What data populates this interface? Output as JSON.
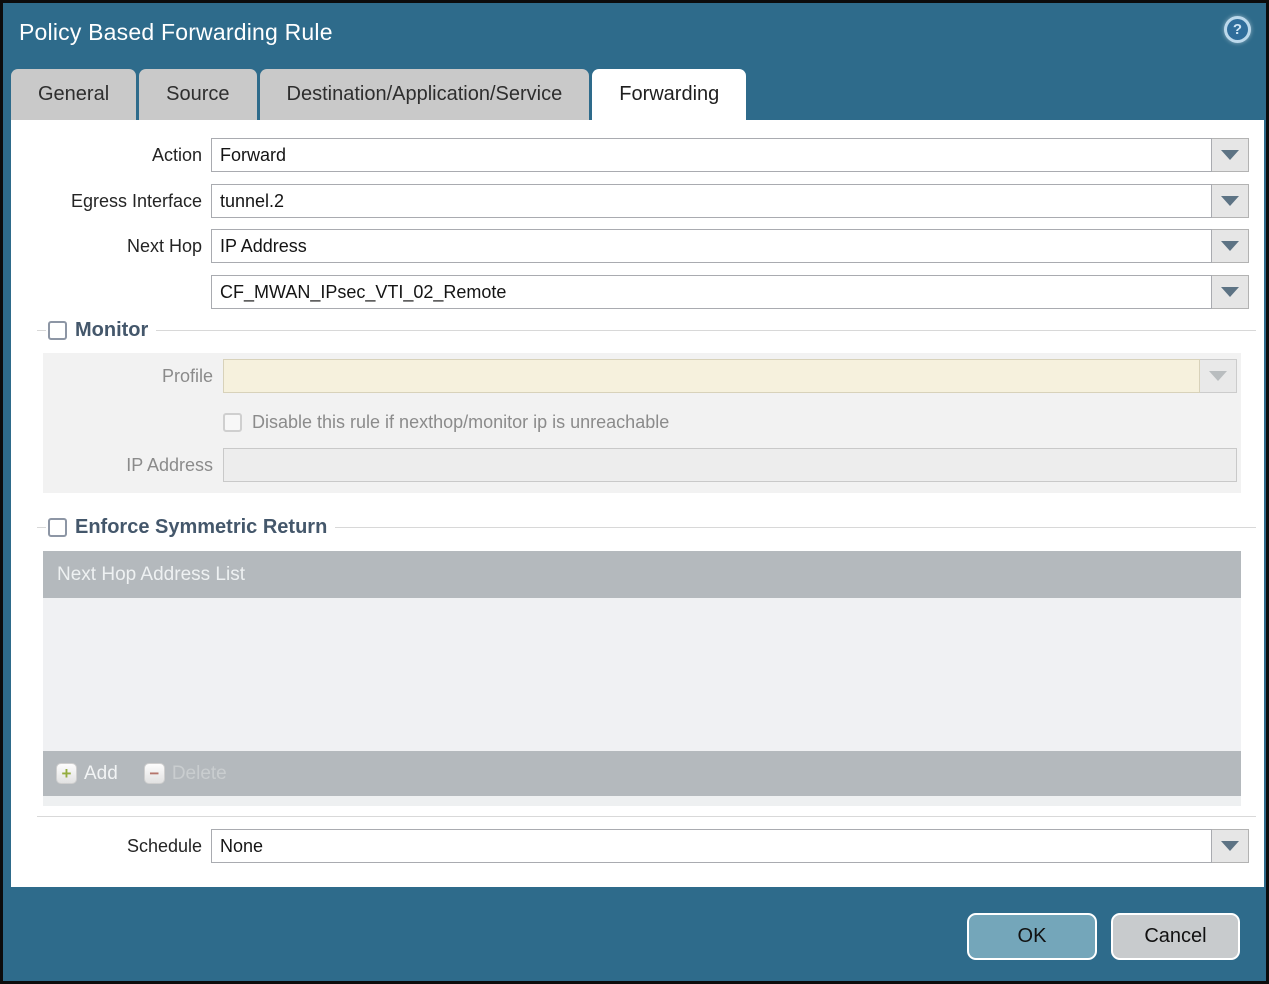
{
  "window": {
    "title": "Policy Based Forwarding Rule",
    "help_glyph": "?"
  },
  "tabs": [
    {
      "label": "General",
      "active": false
    },
    {
      "label": "Source",
      "active": false
    },
    {
      "label": "Destination/Application/Service",
      "active": false
    },
    {
      "label": "Forwarding",
      "active": true
    }
  ],
  "form": {
    "action": {
      "label": "Action",
      "value": "Forward"
    },
    "egress_interface": {
      "label": "Egress Interface",
      "value": "tunnel.2"
    },
    "next_hop": {
      "label": "Next Hop",
      "value": "IP Address"
    },
    "next_hop_address": {
      "value": "CF_MWAN_IPsec_VTI_02_Remote"
    },
    "schedule": {
      "label": "Schedule",
      "value": "None"
    }
  },
  "monitor": {
    "title": "Monitor",
    "checked": false,
    "profile": {
      "label": "Profile",
      "value": ""
    },
    "disable_rule": {
      "label": "Disable this rule if nexthop/monitor ip is unreachable",
      "checked": false
    },
    "ip_address": {
      "label": "IP Address",
      "value": ""
    }
  },
  "enforce_symmetric_return": {
    "title": "Enforce Symmetric Return",
    "checked": false,
    "table": {
      "header": "Next Hop Address List",
      "rows": []
    },
    "add_label": "Add",
    "delete_label": "Delete",
    "delete_enabled": false
  },
  "footer": {
    "ok_label": "OK",
    "cancel_label": "Cancel"
  },
  "colors": {
    "dialog_background": "#2e6b8b",
    "tab_inactive": "#c9c9c9",
    "tab_active": "#ffffff",
    "legend_text": "#44576b",
    "monitor_panel": "#f2f2f2",
    "profile_field": "#f6f1dd",
    "table_header": "#b4b9bd",
    "table_body": "#f0f1f3",
    "ok_button": "#74a6ba",
    "cancel_button": "#c8cbcd",
    "add_icon_green": "#94ad3f",
    "delete_icon_red": "#b5766c"
  }
}
